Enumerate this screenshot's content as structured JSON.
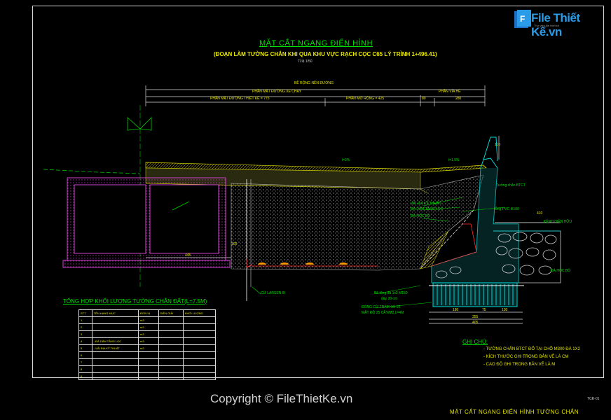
{
  "title": "MẶT CẮT NGANG ĐIỂN HÌNH",
  "subtitle": "(ĐOẠN LÀM TƯỜNG CHẮN KHI QUA KHU VỰC RẠCH  CỌC C65 LÝ TRÌNH 1+496.41)",
  "scale": "Tỉ lệ 1/50",
  "dims": {
    "road_width": "BỀ RỘNG NỀN ĐƯỜNG",
    "carriageway": "PHẦN MẶT ĐƯỜNG XE CHẠY",
    "pavement": "PHẦN VỈA HÈ",
    "design_surface": "PHẦN MẶT ĐƯỜNG THIẾT KẾ = 775",
    "widening": "PHẦN MỞ RỘNG = 425",
    "d80": "80",
    "d280": "280",
    "d110": "110",
    "d445": "445",
    "d100": "100",
    "d410": "410",
    "d180": "180",
    "d75": "75",
    "d130": "130",
    "d355": "355",
    "d405": "405"
  },
  "labels": {
    "slope1": "i=2%",
    "slope2": "i=1.5%",
    "wall": "Tường chắn BTCT",
    "fabric": "VẢI ĐỊA KỸ THUẬT",
    "filter": "ĐÁ DĂM TẦNG LỌC",
    "rubble": "ĐÁ HỘC BỎ",
    "pipe": "Ống PVC Φ100",
    "ditch": "KÊNH HIỆN HỮU",
    "stone": "ĐÁ HỘC BỎ",
    "larsen": "CỪ LARSEN III",
    "concrete1": "Bê tông đá 1x2 M150",
    "concrete2": "dày 20 cm",
    "piles1": "ĐÓNG CỪ TRÀM Φ8-10",
    "piles2": "MẬT ĐỘ 25 CÂY/M2,L=4M"
  },
  "table": {
    "title": "TỔNG HỢP KHỐI LƯỢNG TƯỜNG CHẮN ĐẤT(L=7.5M)",
    "headers": [
      "STT",
      "TÊN HẠNG MỤC",
      "ĐƠN VỊ",
      "DIỄN GIẢI",
      "KHỐI LƯỢNG"
    ],
    "rows": [
      [
        "1",
        "",
        "m3",
        "",
        ""
      ],
      [
        "2",
        "",
        "m3",
        "",
        ""
      ],
      [
        "3",
        "",
        "m3",
        "",
        ""
      ],
      [
        "4",
        "- ĐÁ DĂM TẦNG LỌC",
        "m3",
        "",
        ""
      ],
      [
        "5",
        "- VẢI ĐỊA KỸ THUẬT",
        "m2",
        "",
        ""
      ],
      [
        "6",
        "",
        "",
        "",
        ""
      ],
      [
        "7",
        "",
        "",
        "",
        ""
      ],
      [
        "8",
        "",
        "",
        "",
        ""
      ],
      [
        "9",
        "",
        "",
        "",
        ""
      ]
    ]
  },
  "notes": {
    "title": "GHI CHÚ:",
    "items": [
      "- TƯỜNG CHẮN BTCT ĐỔ TẠI CHỖ M300 ĐÁ 1X2",
      "- KÍCH THƯỚC GHI TRONG BẢN VẼ LÀ CM",
      "- CAO ĐỘ GHI TRONG BẢN VẼ LÀ M"
    ]
  },
  "code": "TCĐ-01",
  "copyright": "Copyright © FileThietKe.vn",
  "bottom_title": "MẶT CẮT NGANG ĐIỂN HÌNH TƯỜNG CHẮN",
  "logo": "File Thiết Kế.vn",
  "logo_sub": "Thư viện file thiết kế"
}
